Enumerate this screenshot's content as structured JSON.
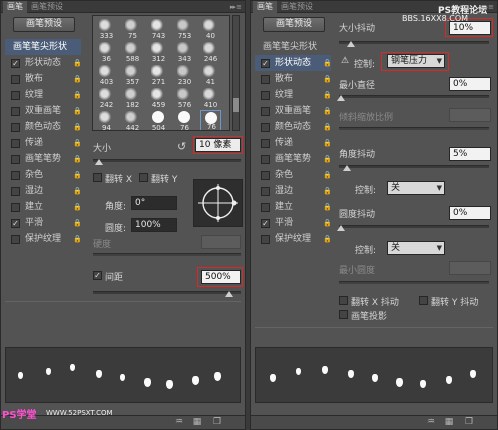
{
  "tabs": {
    "brush": "画笔",
    "brush_presets": "画笔预设"
  },
  "left": {
    "preset_button": "画笔预设",
    "side_items": [
      {
        "label": "画笔笔尖形状",
        "checked": null,
        "selected": true,
        "lock": false
      },
      {
        "label": "形状动态",
        "checked": true,
        "selected": false,
        "lock": true
      },
      {
        "label": "散布",
        "checked": false,
        "selected": false,
        "lock": true
      },
      {
        "label": "纹理",
        "checked": false,
        "selected": false,
        "lock": true
      },
      {
        "label": "双重画笔",
        "checked": false,
        "selected": false,
        "lock": true
      },
      {
        "label": "颜色动态",
        "checked": false,
        "selected": false,
        "lock": true
      },
      {
        "label": "传递",
        "checked": false,
        "selected": false,
        "lock": true
      },
      {
        "label": "画笔笔势",
        "checked": false,
        "selected": false,
        "lock": true
      },
      {
        "label": "杂色",
        "checked": false,
        "selected": false,
        "lock": true
      },
      {
        "label": "湿边",
        "checked": false,
        "selected": false,
        "lock": true
      },
      {
        "label": "建立",
        "checked": false,
        "selected": false,
        "lock": true
      },
      {
        "label": "平滑",
        "checked": true,
        "selected": false,
        "lock": true
      },
      {
        "label": "保护纹理",
        "checked": false,
        "selected": false,
        "lock": true
      }
    ],
    "brush_tips": [
      "333",
      "75",
      "743",
      "753",
      "40",
      "36",
      "588",
      "312",
      "343",
      "246",
      "403",
      "357",
      "271",
      "230",
      "41",
      "242",
      "182",
      "459",
      "576",
      "410",
      "94",
      "442",
      "504",
      "76",
      "76"
    ],
    "size_label": "大小",
    "size_value": "10 像素",
    "flip_x": "翻转 X",
    "flip_y": "翻转 Y",
    "angle_label": "角度:",
    "angle_value": "0°",
    "roundness_label": "圆度:",
    "roundness_value": "100%",
    "hardness_label": "硬度",
    "spacing_label": "间距",
    "spacing_checked": true,
    "spacing_value": "500%"
  },
  "right": {
    "preset_button": "画笔预设",
    "size_jitter_label": "大小抖动",
    "size_jitter_value": "10%",
    "control_label": "控制:",
    "control_value": "钢笔压力",
    "min_diameter_label": "最小直径",
    "min_diameter_value": "0%",
    "tilt_scale_label": "倾斜缩放比例",
    "angle_jitter_label": "角度抖动",
    "angle_jitter_value": "5%",
    "control2_value": "关",
    "roundness_jitter_label": "圆度抖动",
    "roundness_jitter_value": "0%",
    "control3_value": "关",
    "min_roundness_label": "最小圆度",
    "flip_x_jitter": "翻转 X 抖动",
    "flip_y_jitter": "翻转 Y 抖动",
    "brush_projection": "画笔投影",
    "side_items": [
      {
        "label": "画笔笔尖形状",
        "checked": null,
        "selected": false,
        "lock": false
      },
      {
        "label": "形状动态",
        "checked": true,
        "selected": true,
        "lock": true
      },
      {
        "label": "散布",
        "checked": false,
        "selected": false,
        "lock": true
      },
      {
        "label": "纹理",
        "checked": false,
        "selected": false,
        "lock": true
      },
      {
        "label": "双重画笔",
        "checked": false,
        "selected": false,
        "lock": true
      },
      {
        "label": "颜色动态",
        "checked": false,
        "selected": false,
        "lock": true
      },
      {
        "label": "传递",
        "checked": false,
        "selected": false,
        "lock": true
      },
      {
        "label": "画笔笔势",
        "checked": false,
        "selected": false,
        "lock": true
      },
      {
        "label": "杂色",
        "checked": false,
        "selected": false,
        "lock": true
      },
      {
        "label": "湿边",
        "checked": false,
        "selected": false,
        "lock": true
      },
      {
        "label": "建立",
        "checked": false,
        "selected": false,
        "lock": true
      },
      {
        "label": "平滑",
        "checked": true,
        "selected": false,
        "lock": true
      },
      {
        "label": "保护纹理",
        "checked": false,
        "selected": false,
        "lock": true
      }
    ]
  },
  "watermark": {
    "tr_line1": "PS教程论坛",
    "tr_line2": "BBS.16XX8.COM",
    "bl_brand": "PS学堂",
    "bl_site": "WWW.52PSXT.COM"
  },
  "icons": {
    "warning": "warning-icon",
    "reset": "reset-icon",
    "lock": "lock-icon",
    "menu": "panel-menu-icon"
  },
  "colors": {
    "panel": "#535353",
    "highlight_box": "#d8292a",
    "selected_row": "#4b5c78"
  }
}
